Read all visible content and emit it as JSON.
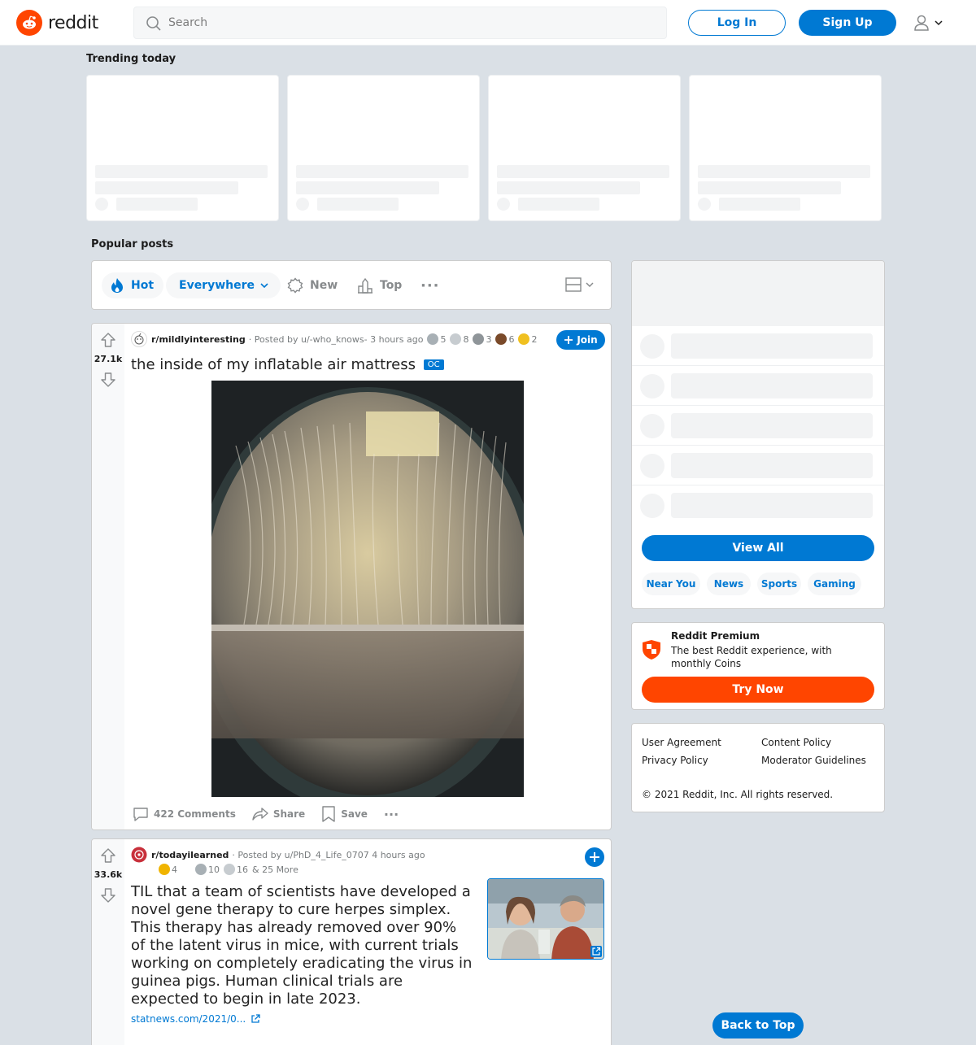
{
  "header": {
    "logo_text": "reddit",
    "search_placeholder": "Search",
    "login_label": "Log In",
    "signup_label": "Sign Up"
  },
  "trending": {
    "title": "Trending today"
  },
  "popular": {
    "title": "Popular posts",
    "sort": {
      "hot": "Hot",
      "everywhere": "Everywhere",
      "new": "New",
      "top": "Top",
      "more": "···"
    }
  },
  "posts": [
    {
      "votes": "27.1k",
      "subreddit": "r/mildlyinteresting",
      "posted_by": "· Posted by u/-who_knows- 3 hours ago",
      "awards": [
        {
          "icon": "silver-award-icon",
          "count": "5",
          "color": "#a8b0b5"
        },
        {
          "icon": "helpful-award-icon",
          "count": "8",
          "color": "#c7ccd0"
        },
        {
          "icon": "s-award-icon",
          "count": "3",
          "color": "#8f9599"
        },
        {
          "icon": "poop-award-icon",
          "count": "6",
          "color": "#7a4a2a"
        },
        {
          "icon": "wholesome-award-icon",
          "count": "2",
          "color": "#f0c020"
        }
      ],
      "join_label": "Join",
      "title": "the inside of my inflatable air mattress",
      "flair": "OC",
      "comments": "422 Comments",
      "share": "Share",
      "save": "Save"
    },
    {
      "votes": "33.6k",
      "subreddit": "r/todayilearned",
      "posted_by": "· Posted by u/PhD_4_Life_0707 4 hours ago",
      "awards": [
        {
          "icon": "gold-award-icon",
          "count": "4",
          "color": "#f0b400"
        },
        {
          "icon": "silver-award-icon",
          "count": "10",
          "color": "#a8b0b5"
        },
        {
          "icon": "helpful-award-icon",
          "count": "16",
          "color": "#c7ccd0"
        }
      ],
      "more_awards": "& 25 More",
      "title": "TIL that a team of scientists have developed a novel gene therapy to cure herpes simplex. This therapy has already removed over 90% of the latent virus in mice, with current trials working on completely eradicating the virus in guinea pigs. Human clinical trials are expected to begin in late 2023.",
      "link_text": "statnews.com/2021/0..."
    }
  ],
  "sidebar": {
    "view_all": "View All",
    "chips": [
      "Near You",
      "News",
      "Sports",
      "Gaming"
    ],
    "premium_title": "Reddit Premium",
    "premium_desc": "The best Reddit experience, with monthly Coins",
    "try_now": "Try Now",
    "footer_links": [
      "User Agreement",
      "Content Policy",
      "Privacy Policy",
      "Moderator Guidelines"
    ],
    "copyright": "© 2021 Reddit, Inc. All rights reserved."
  },
  "back_to_top": "Back to Top",
  "colors": {
    "brand": "#ff4500",
    "accent": "#0079d3",
    "background": "#dae0e6"
  }
}
